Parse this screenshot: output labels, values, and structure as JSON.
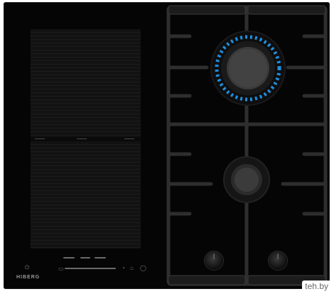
{
  "product": {
    "brand_label": "HIBERG",
    "watermark": "teh.by"
  },
  "induction": {
    "zones": [
      "flex-zone-top",
      "flex-zone-bottom"
    ]
  },
  "gas": {
    "burners": [
      {
        "name": "large-burner",
        "flame_color": "#1f8fe0"
      },
      {
        "name": "small-burner",
        "flame_color": ""
      }
    ]
  },
  "colors": {
    "glass": "#050505",
    "grate": "#333333",
    "flame": "#1f8fe0"
  }
}
